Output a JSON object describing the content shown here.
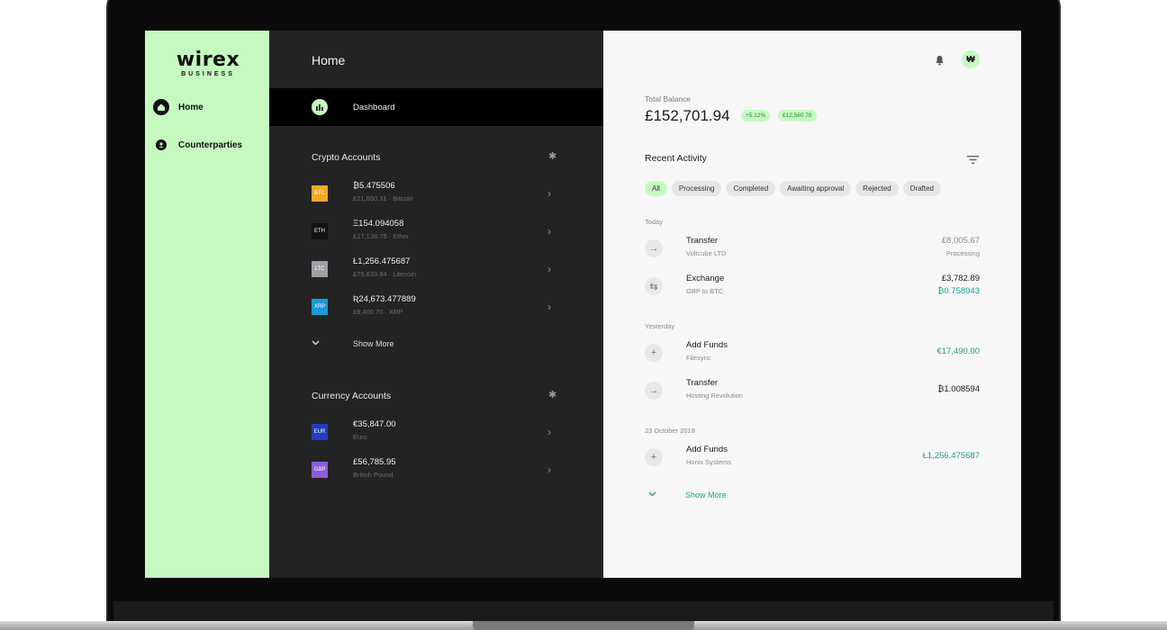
{
  "logo": {
    "main": "wirex",
    "sub": "BUSINESS"
  },
  "sidebar": {
    "items": [
      {
        "label": "Home",
        "icon": "home-icon"
      },
      {
        "label": "Counterparties",
        "icon": "person-icon"
      }
    ]
  },
  "middle": {
    "title": "Home",
    "dashboard_label": "Dashboard",
    "crypto": {
      "title": "Crypto Accounts",
      "accounts": [
        {
          "code": "BTC",
          "amount": "₿5.475506",
          "sub": "£21,650.31 · Bitcoin",
          "color": "#f5a623"
        },
        {
          "code": "ETH",
          "amount": "Ξ154.094058",
          "sub": "£17,138.75 · Ether",
          "color": "#111111"
        },
        {
          "code": "LTC",
          "amount": "Ł1,256.475687",
          "sub": "£75,639.84 · Litecoin",
          "color": "#9aa0a6"
        },
        {
          "code": "XRP",
          "amount": "Ʀ24,673.477889",
          "sub": "£8,400.70 · XRP",
          "color": "#1b9ad6"
        }
      ],
      "show_more": "Show More"
    },
    "currency": {
      "title": "Currency Accounts",
      "accounts": [
        {
          "code": "EUR",
          "amount": "€35,847.00",
          "sub": "Euro",
          "color": "#1f3fbf"
        },
        {
          "code": "GBP",
          "amount": "£56,785.95",
          "sub": "British Pound",
          "color": "#8e5bd9"
        }
      ]
    }
  },
  "right": {
    "avatar": "₩",
    "total_balance_label": "Total Balance",
    "total_balance_value": "£152,701.94",
    "change_pct": "+5.12%",
    "change_amt": "£12,560.78",
    "recent_activity_title": "Recent Activity",
    "filters": [
      "All",
      "Processing",
      "Completed",
      "Awaiting approval",
      "Rejected",
      "Drafted"
    ],
    "groups": [
      {
        "day": "Today",
        "items": [
          {
            "title": "Transfer",
            "sub": "Voltcube LTD",
            "amount": "£8,005.67",
            "amount2": "Processing",
            "icon": "arrow-right-icon"
          },
          {
            "title": "Exchange",
            "sub": "GBP to BTC",
            "amount": "£3,782.89",
            "amount2": "₿0.758943",
            "icon": "exchange-icon"
          }
        ]
      },
      {
        "day": "Yesterday",
        "items": [
          {
            "title": "Add Funds",
            "sub": "Filesync",
            "amount": "€17,490.00",
            "amount2": "",
            "icon": "plus-icon"
          },
          {
            "title": "Transfer",
            "sub": "Hosting Revolution",
            "amount": "₿1.008594",
            "amount2": "",
            "icon": "arrow-right-icon"
          }
        ]
      },
      {
        "day": "23 October 2018",
        "items": [
          {
            "title": "Add Funds",
            "sub": "Honix Systems",
            "amount": "Ł1,256.475687",
            "amount2": "",
            "icon": "plus-icon"
          }
        ]
      }
    ],
    "show_more": "Show More"
  },
  "colors": {
    "accent_green": "#c6f9c0",
    "teal": "#1f9c8a",
    "dark_panel": "#232323"
  }
}
